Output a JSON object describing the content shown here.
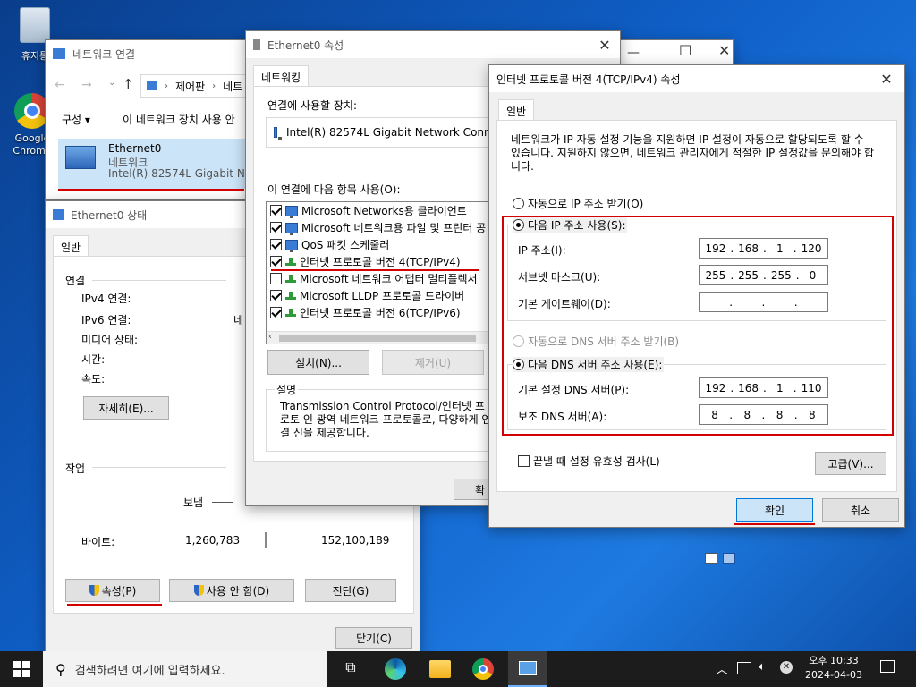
{
  "desktop": {
    "recycle_bin": "휴지통",
    "chrome": "Google Chrome"
  },
  "net_connections": {
    "title": "네트워크 연결",
    "breadcrumb": [
      "제어판",
      "네트"
    ],
    "toolbar": {
      "organize": "구성 ▾",
      "disable": "이 네트워크 장치 사용 안"
    },
    "adapter": {
      "name": "Ethernet0",
      "type": "네트워크",
      "device": "Intel(R) 82574L Gigabit Netw"
    }
  },
  "eth_status": {
    "title": "Ethernet0 상태",
    "tab": "일반",
    "connection_header": "연결",
    "ipv4_label": "IPv4 연결:",
    "ipv6_label": "IPv6 연결:",
    "ipv6_value": "네",
    "media_label": "미디어 상태:",
    "time_label": "시간:",
    "speed_label": "속도:",
    "details_button": "자세히(E)...",
    "activity_header": "작업",
    "sent_label": "보냄",
    "bytes_label": "바이트:",
    "bytes_sent": "1,260,783",
    "bytes_received": "152,100,189",
    "properties_button": "속성(P)",
    "disable_button": "사용 안 함(D)",
    "diagnose_button": "진단(G)",
    "close_button": "닫기(C)"
  },
  "eth_props": {
    "title": "Ethernet0 속성",
    "tab": "네트워킹",
    "connect_using_label": "연결에 사용할 장치:",
    "device": "Intel(R) 82574L Gigabit Network Conne",
    "items_label": "이 연결에 다음 항목 사용(O):",
    "items": [
      {
        "label": "Microsoft Networks용 클라이언트",
        "checked": true
      },
      {
        "label": "Microsoft 네트워크용 파일 및 프린터 공",
        "checked": true
      },
      {
        "label": "QoS 패킷 스케줄러",
        "checked": true
      },
      {
        "label": "인터넷 프로토콜 버전 4(TCP/IPv4)",
        "checked": true
      },
      {
        "label": "Microsoft 네트워크 어댑터 멀티플렉서",
        "checked": false
      },
      {
        "label": "Microsoft LLDP 프로토콜 드라이버",
        "checked": true
      },
      {
        "label": "인터넷 프로토콜 버전 6(TCP/IPv6)",
        "checked": true
      }
    ],
    "install_button": "설치(N)...",
    "remove_button": "제거(U)",
    "description_header": "설명",
    "description": "Transmission Control Protocol/인터넷 프로토 인 광역 네트워크 프로토콜로, 다양하게 연결 신을 제공합니다.",
    "ok_partial": "확"
  },
  "ipv4_dialog": {
    "title": "인터넷 프로토콜 버전 4(TCP/IPv4) 속성",
    "tab": "일반",
    "intro": "네트워크가 IP 자동 설정 기능을 지원하면 IP 설정이 자동으로 할당되도록 할 수 있습니다. 지원하지 않으면, 네트워크 관리자에게 적절한 IP 설정값을 문의해야 합니다.",
    "auto_ip": "자동으로 IP 주소 받기(O)",
    "manual_ip": "다음 IP 주소 사용(S):",
    "ip_label": "IP 주소(I):",
    "ip_value": [
      "192",
      "168",
      "1",
      "120"
    ],
    "subnet_label": "서브넷 마스크(U):",
    "subnet_value": [
      "255",
      "255",
      "255",
      "0"
    ],
    "gateway_label": "기본 게이트웨이(D):",
    "gateway_value": [
      "",
      "",
      "",
      ""
    ],
    "auto_dns": "자동으로 DNS 서버 주소 받기(B)",
    "manual_dns": "다음 DNS 서버 주소 사용(E):",
    "pref_dns_label": "기본 설정 DNS 서버(P):",
    "pref_dns_value": [
      "192",
      "168",
      "1",
      "110"
    ],
    "alt_dns_label": "보조 DNS 서버(A):",
    "alt_dns_value": [
      "8",
      "8",
      "8",
      "8"
    ],
    "validate_label": "끝낼 때 설정 유효성 검사(L)",
    "advanced_button": "고급(V)...",
    "ok_button": "확인",
    "cancel_button": "취소"
  },
  "taskbar": {
    "search_placeholder": "검색하려면 여기에 입력하세요.",
    "time": "오후 10:33",
    "date": "2024-04-03"
  },
  "colors": {
    "highlight_red": "#d40000",
    "taskbar": "#1c1c1c",
    "accent": "#0078d7"
  }
}
